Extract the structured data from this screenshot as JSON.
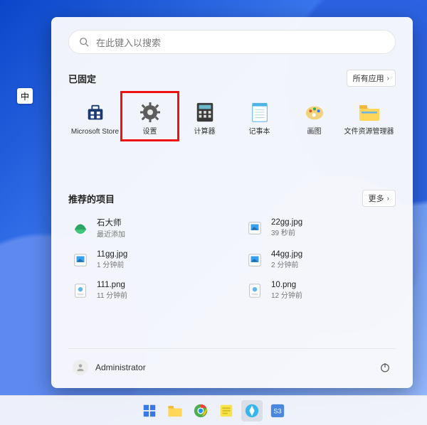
{
  "ime_badge": "中",
  "search": {
    "placeholder": "在此键入以搜索"
  },
  "pinned": {
    "title": "已固定",
    "button": "所有应用",
    "apps": [
      {
        "label": "Microsoft Store",
        "icon": "store-icon"
      },
      {
        "label": "设置",
        "icon": "gear-icon",
        "highlighted": true
      },
      {
        "label": "计算器",
        "icon": "calculator-icon"
      },
      {
        "label": "记事本",
        "icon": "notepad-icon"
      },
      {
        "label": "画图",
        "icon": "paint-icon"
      },
      {
        "label": "文件资源管理器",
        "icon": "explorer-icon"
      }
    ]
  },
  "recommended": {
    "title": "推荐的项目",
    "button": "更多",
    "items": [
      {
        "title": "石大师",
        "sub": "最近添加",
        "icon": "app-green-icon"
      },
      {
        "title": "22gg.jpg",
        "sub": "39 秒前",
        "icon": "image-file-icon"
      },
      {
        "title": "11gg.jpg",
        "sub": "1 分钟前",
        "icon": "image-file-icon"
      },
      {
        "title": "44gg.jpg",
        "sub": "2 分钟前",
        "icon": "image-file-icon"
      },
      {
        "title": "111.png",
        "sub": "11 分钟前",
        "icon": "png-file-icon"
      },
      {
        "title": "10.png",
        "sub": "12 分钟前",
        "icon": "png-file-icon"
      }
    ]
  },
  "footer": {
    "user_name": "Administrator"
  },
  "taskbar": {
    "items": [
      {
        "icon": "start-icon",
        "active": false
      },
      {
        "icon": "explorer-icon",
        "active": false
      },
      {
        "icon": "chrome-icon",
        "active": false
      },
      {
        "icon": "note-app-icon",
        "active": false
      },
      {
        "icon": "browser2-icon",
        "active": true
      },
      {
        "icon": "s3-app-icon",
        "active": false
      }
    ]
  }
}
